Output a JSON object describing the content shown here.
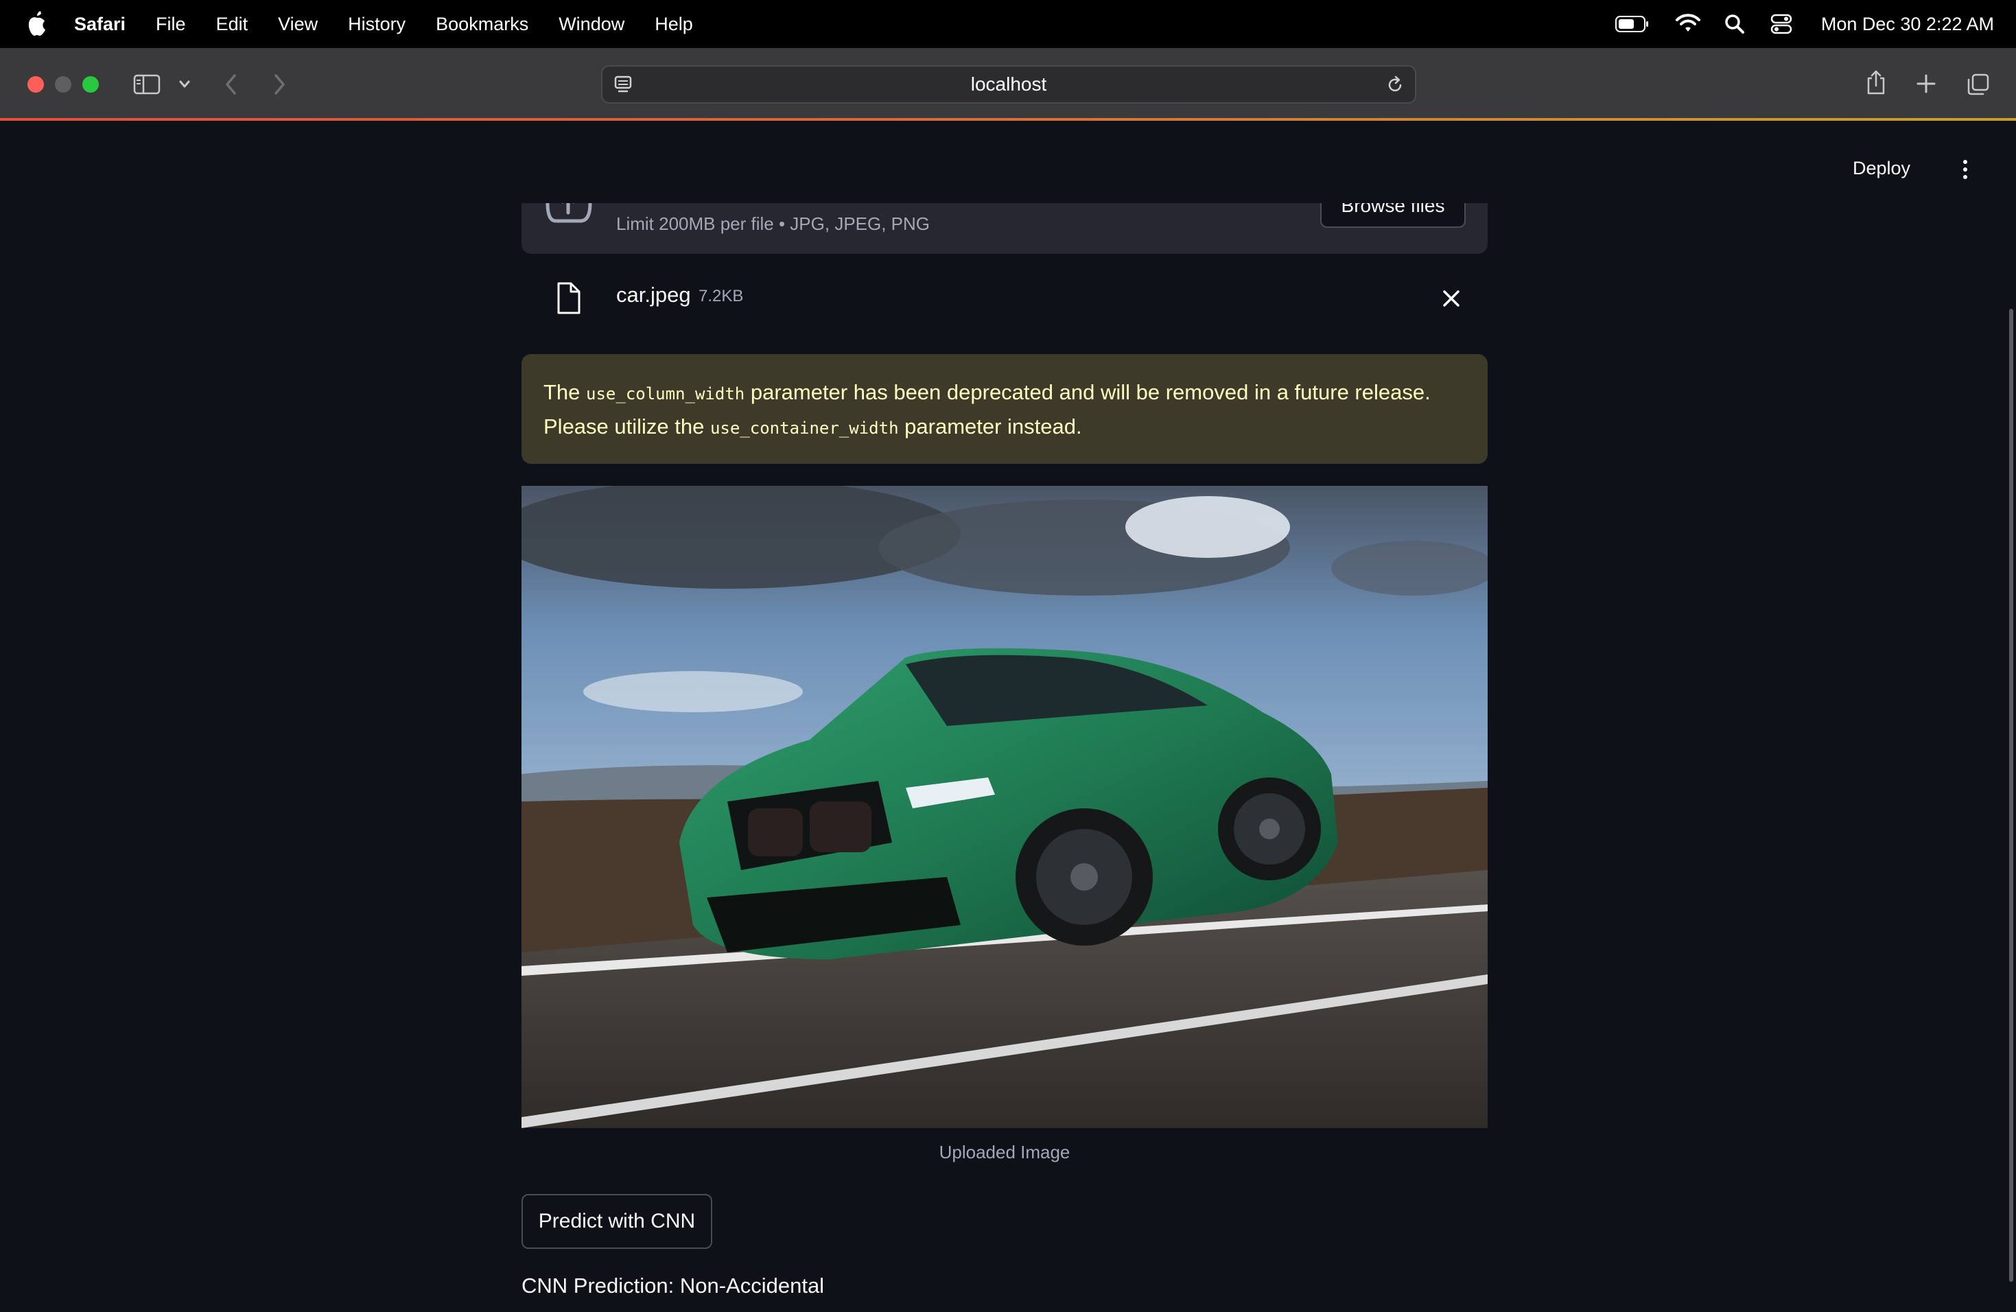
{
  "menubar": {
    "app_name": "Safari",
    "menus": [
      "File",
      "Edit",
      "View",
      "History",
      "Bookmarks",
      "Window",
      "Help"
    ],
    "clock": "Mon Dec 30  2:22 AM"
  },
  "browser": {
    "url": "localhost"
  },
  "app": {
    "deploy_label": "Deploy",
    "uploader": {
      "limit_text": "Limit 200MB per file • JPG, JPEG, PNG",
      "browse_label": "Browse files"
    },
    "file": {
      "name": "car.jpeg",
      "size": "7.2KB"
    },
    "warning": {
      "part1": "The ",
      "code1": "use_column_width",
      "part2": " parameter has been deprecated and will be removed in a future release. Please utilize the ",
      "code2": "use_container_width",
      "part3": " parameter instead."
    },
    "image_caption": "Uploaded Image",
    "predict_label": "Predict with CNN",
    "prediction": "CNN Prediction: Non-Accidental"
  },
  "colors": {
    "page_bg": "#0e1117",
    "warning_bg": "#3d3a2a",
    "warning_text": "#ffffc2",
    "car_green": "#1f7a52"
  }
}
